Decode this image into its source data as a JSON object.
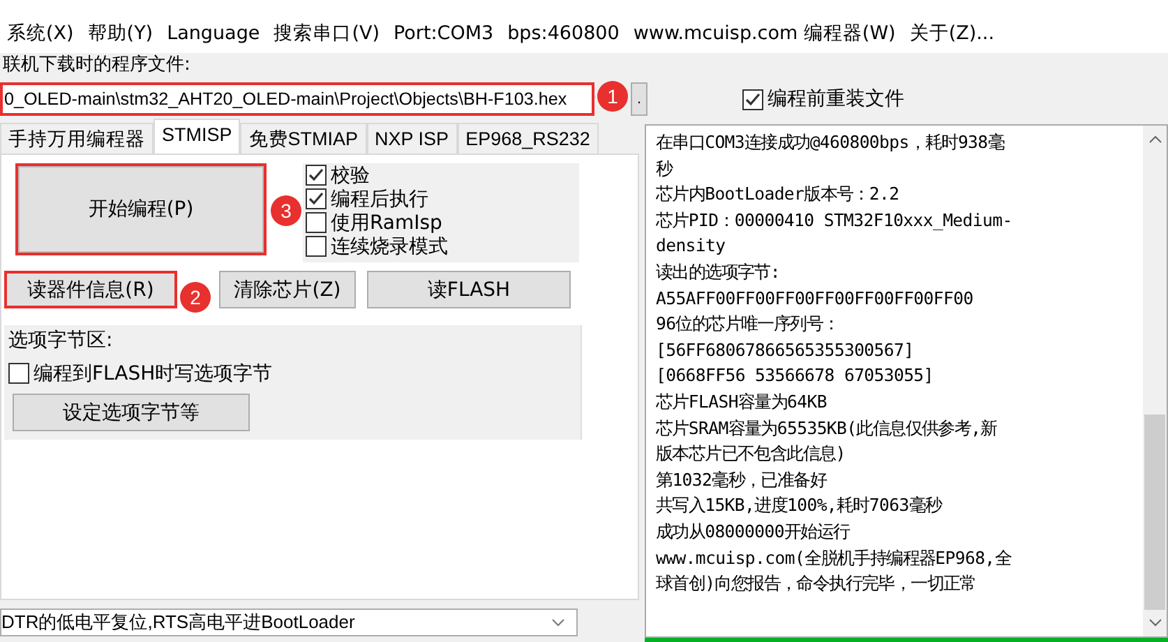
{
  "menu": [
    "系统(X)",
    "帮助(Y)",
    "Language",
    "搜索串口(V)",
    "Port:COM3",
    "bps:460800",
    "www.mcuisp.com 编程器(W)",
    "关于(Z)..."
  ],
  "file_label": "联机下载时的程序文件:",
  "file_field": {
    "value": "0_OLED-main\\stm32_AHT20_OLED-main\\Project\\Objects\\BH-F103.hex",
    "callout": "1",
    "browse": "."
  },
  "reload_option": {
    "label": "编程前重装文件",
    "checked": true
  },
  "tabs": [
    {
      "label": "手持万用编程器",
      "selected": false
    },
    {
      "label": "STMISP",
      "selected": true
    },
    {
      "label": "免费STMIAP",
      "selected": false
    },
    {
      "label": "NXP ISP",
      "selected": false
    },
    {
      "label": "EP968_RS232",
      "selected": false
    }
  ],
  "program_button": {
    "label": "开始编程(P)",
    "callout": "3"
  },
  "options": [
    {
      "label": "校验",
      "checked": true
    },
    {
      "label": "编程后执行",
      "checked": true
    },
    {
      "label": "使用RamIsp",
      "checked": false
    },
    {
      "label": "连续烧录模式",
      "checked": false
    }
  ],
  "actions": [
    {
      "label": "读器件信息(R)",
      "callout": "2"
    },
    {
      "label": "清除芯片(Z)"
    },
    {
      "label": "读FLASH"
    }
  ],
  "option_bytes": {
    "title": "选项字节区:",
    "write_option": {
      "label": "编程到FLASH时写选项字节",
      "checked": false
    },
    "button": "设定选项字节等"
  },
  "reset_mode": {
    "value": "DTR的低电平复位,RTS高电平进BootLoader"
  },
  "log": [
    "在串口COM3连接成功@460800bps，耗时938毫",
    "秒",
    "芯片内BootLoader版本号：2.2",
    "芯片PID：00000410  STM32F10xxx_Medium-",
    "density",
    "读出的选项字节:",
    "A55AFF00FF00FF00FF00FF00FF00FF00",
    "96位的芯片唯一序列号：",
    "[56FF68067866565355300567]",
    "[0668FF56 53566678 67053055]",
    "芯片FLASH容量为64KB",
    "芯片SRAM容量为65535KB(此信息仅供参考,新",
    "版本芯片已不包含此信息)",
    "第1032毫秒，已准备好",
    "共写入15KB,进度100%,耗时7063毫秒",
    "成功从08000000开始运行",
    "www.mcuisp.com(全脱机手持编程器EP968,全",
    "球首创)向您报告，命令执行完毕，一切正常"
  ],
  "progress": {
    "level": 1
  }
}
